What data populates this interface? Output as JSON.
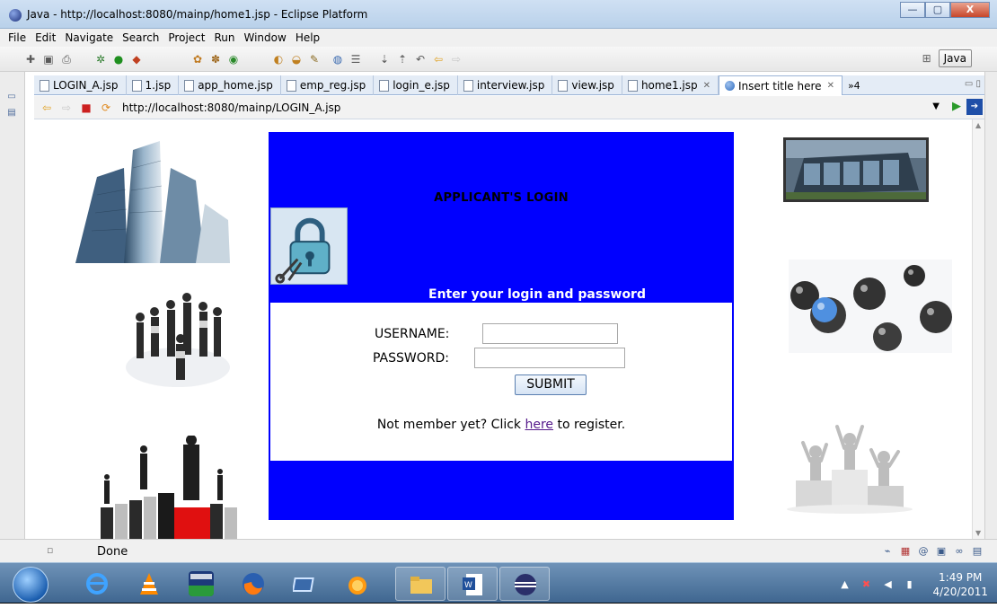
{
  "window": {
    "title": "Java - http://localhost:8080/mainp/home1.jsp - Eclipse Platform",
    "minimize": "—",
    "maximize": "▢",
    "close": "X"
  },
  "menu": [
    "File",
    "Edit",
    "Navigate",
    "Search",
    "Project",
    "Run",
    "Window",
    "Help"
  ],
  "perspective": {
    "label": "Java"
  },
  "tabs": [
    {
      "label": "LOGIN_A.jsp",
      "active": false
    },
    {
      "label": "1.jsp",
      "active": false
    },
    {
      "label": "app_home.jsp",
      "active": false
    },
    {
      "label": "emp_reg.jsp",
      "active": false
    },
    {
      "label": "login_e.jsp",
      "active": false
    },
    {
      "label": "interview.jsp",
      "active": false
    },
    {
      "label": "view.jsp",
      "active": false
    },
    {
      "label": "home1.jsp",
      "active": false
    },
    {
      "label": "Insert title here",
      "active": true
    }
  ],
  "tab_overflow": "»4",
  "browser": {
    "url": "http://localhost:8080/mainp/LOGIN_A.jsp"
  },
  "login": {
    "title": "APPLICANT'S LOGIN",
    "prompt": "Enter your login and password",
    "username_label": "USERNAME:",
    "password_label": "PASSWORD:",
    "username_value": "",
    "password_value": "",
    "submit_label": "SUBMIT",
    "register_prefix": "Not member yet? Click ",
    "register_link": "here",
    "register_suffix": " to register."
  },
  "status": {
    "text": "Done"
  },
  "taskbar": {
    "time": "1:49 PM",
    "date": "4/20/2011"
  },
  "colors": {
    "panel_blue": "#0000ff",
    "link_visited": "#551a8b"
  }
}
